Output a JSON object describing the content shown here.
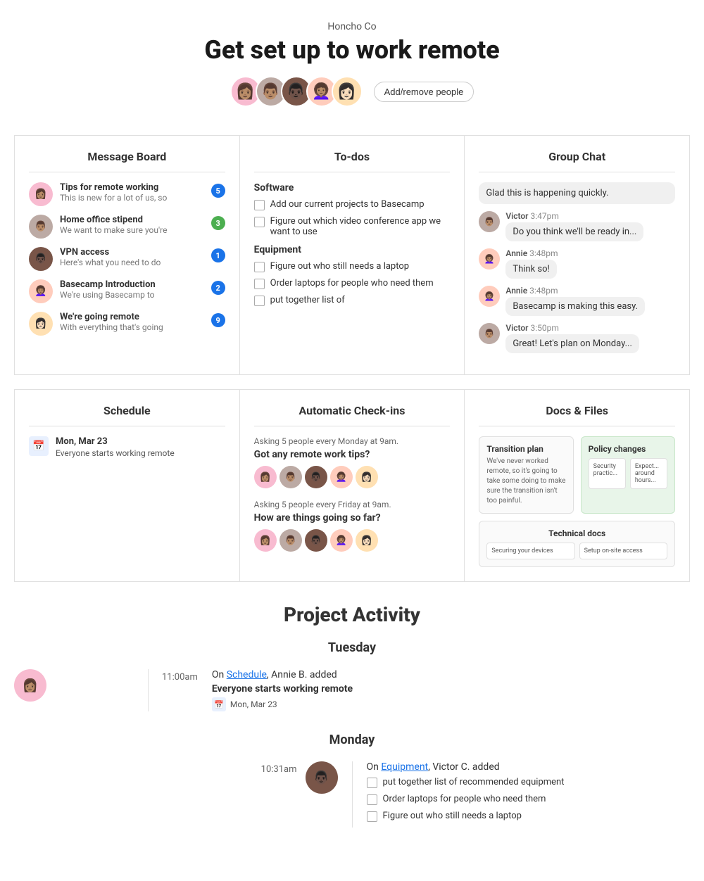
{
  "header": {
    "subtitle": "Honcho Co",
    "title": "Get set up to work remote",
    "add_people_label": "Add/remove people",
    "avatars": [
      {
        "emoji": "👩🏽",
        "color": "#f8bbd0"
      },
      {
        "emoji": "👨🏽",
        "color": "#bcaaa4"
      },
      {
        "emoji": "👨🏿",
        "color": "#795548"
      },
      {
        "emoji": "👩🏽‍🦱",
        "color": "#ffccbc"
      },
      {
        "emoji": "👩🏻",
        "color": "#ffe0b2"
      }
    ]
  },
  "message_board": {
    "title": "Message Board",
    "items": [
      {
        "title": "Tips for remote working",
        "preview": "This is new for a lot of us, so",
        "badge": "5",
        "badge_color": "blue"
      },
      {
        "title": "Home office stipend",
        "preview": "We want to make sure you're",
        "badge": "3",
        "badge_color": "green"
      },
      {
        "title": "VPN access",
        "preview": "Here's what you need to do",
        "badge": "1",
        "badge_color": "blue"
      },
      {
        "title": "Basecamp Introduction",
        "preview": "We're using Basecamp to",
        "badge": "2",
        "badge_color": "blue"
      },
      {
        "title": "We're going remote",
        "preview": "With everything that's going",
        "badge": "9",
        "badge_color": "blue"
      }
    ]
  },
  "todos": {
    "title": "To-dos",
    "sections": [
      {
        "title": "Software",
        "items": [
          "Add our current projects to Basecamp",
          "Figure out which video conference app we want to use"
        ]
      },
      {
        "title": "Equipment",
        "items": [
          "Figure out who still needs a laptop",
          "Order laptops for people who need them",
          "put together list of"
        ]
      }
    ]
  },
  "group_chat": {
    "title": "Group Chat",
    "messages": [
      {
        "type": "bubble-only",
        "text": "Glad this is happening quickly.",
        "avatar": null,
        "name": null,
        "time": null
      },
      {
        "type": "with-avatar",
        "name": "Victor",
        "time": "3:47pm",
        "text": "Do you think we'll be ready in...",
        "avatar_color": "#bcaaa4",
        "avatar_emoji": "👨🏽"
      },
      {
        "type": "with-avatar",
        "name": "Annie",
        "time": "3:48pm",
        "text": "Think so!",
        "avatar_color": "#ffccbc",
        "avatar_emoji": "👩🏽‍🦱"
      },
      {
        "type": "with-avatar",
        "name": "Annie",
        "time": "3:48pm",
        "text": "Basecamp is making this easy.",
        "avatar_color": "#ffccbc",
        "avatar_emoji": "👩🏽‍🦱"
      },
      {
        "type": "with-avatar",
        "name": "Victor",
        "time": "3:50pm",
        "text": "Great! Let's plan on Monday...",
        "avatar_color": "#bcaaa4",
        "avatar_emoji": "👨🏽"
      }
    ]
  },
  "schedule": {
    "title": "Schedule",
    "events": [
      {
        "date": "Mon, Mar 23",
        "description": "Everyone starts working remote"
      }
    ]
  },
  "automatic_checkins": {
    "title": "Automatic Check-ins",
    "checkins": [
      {
        "asking": "Asking 5 people every Monday at 9am.",
        "question": "Got any remote work tips?",
        "avatars": [
          "👩🏽",
          "👨🏽",
          "👨🏿",
          "👩🏽‍🦱",
          "👩🏻"
        ]
      },
      {
        "asking": "Asking 5 people every Friday at 9am.",
        "question": "How are things going so far?",
        "avatars": [
          "👩🏽",
          "👨🏽",
          "👨🏿",
          "👩🏽‍🦱",
          "👩🏻"
        ]
      }
    ]
  },
  "docs_files": {
    "title": "Docs & Files",
    "docs": [
      {
        "title": "Transition plan",
        "text": "We've never worked remote, so it's going to take some doing to make sure the transition isn't too painful.",
        "color": "white"
      },
      {
        "title": "Policy changes",
        "text": "Security practic... Expect... around hours...",
        "color": "green"
      },
      {
        "title": "Technical docs",
        "sub_items": [
          "Securing your devices",
          "Setup on-site access"
        ],
        "full_width": true
      }
    ]
  },
  "project_activity": {
    "title": "Project Activity",
    "days": [
      {
        "label": "Tuesday",
        "events": [
          {
            "time": "11:00am",
            "avatar_emoji": "👩🏽",
            "avatar_color": "#f8bbd0",
            "heading": "On Schedule, Annie B. added",
            "link_text": "Schedule",
            "event_title": "Everyone starts working remote",
            "tag_icon": "📅",
            "tag_text": "Mon, Mar 23"
          }
        ]
      },
      {
        "label": "Monday",
        "events": [
          {
            "time": "10:31am",
            "avatar_emoji": "👨🏿",
            "avatar_color": "#795548",
            "heading": "On Equipment, Victor C. added",
            "link_text": "Equipment",
            "todos": [
              "put together list of recommended equipment",
              "Order laptops for people who need them",
              "Figure out who still needs a laptop"
            ]
          }
        ]
      }
    ]
  }
}
